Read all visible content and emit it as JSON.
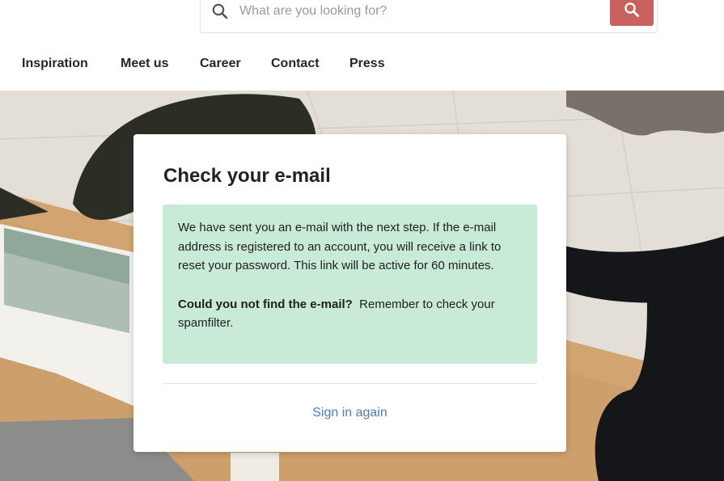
{
  "search": {
    "placeholder": "What are you looking for?",
    "value": ""
  },
  "nav": {
    "items": [
      {
        "label": "Inspiration"
      },
      {
        "label": "Meet us"
      },
      {
        "label": "Career"
      },
      {
        "label": "Contact"
      },
      {
        "label": "Press"
      }
    ]
  },
  "card": {
    "title": "Check your e-mail",
    "message": "We have sent you an e-mail with the next step. If the e-mail address is registered to an account, you will receive a link to reset your password. This link will be active for 60 minutes.",
    "hint_bold": "Could you not find the e-mail?",
    "hint_text": "Remember to check your spamfilter.",
    "signin_label": "Sign in again"
  },
  "colors": {
    "accent": "#c9615e",
    "info_background": "#c8ead7",
    "link": "#4a7fb8"
  },
  "icons": {
    "search_field": "search-icon",
    "search_button": "search-icon"
  }
}
